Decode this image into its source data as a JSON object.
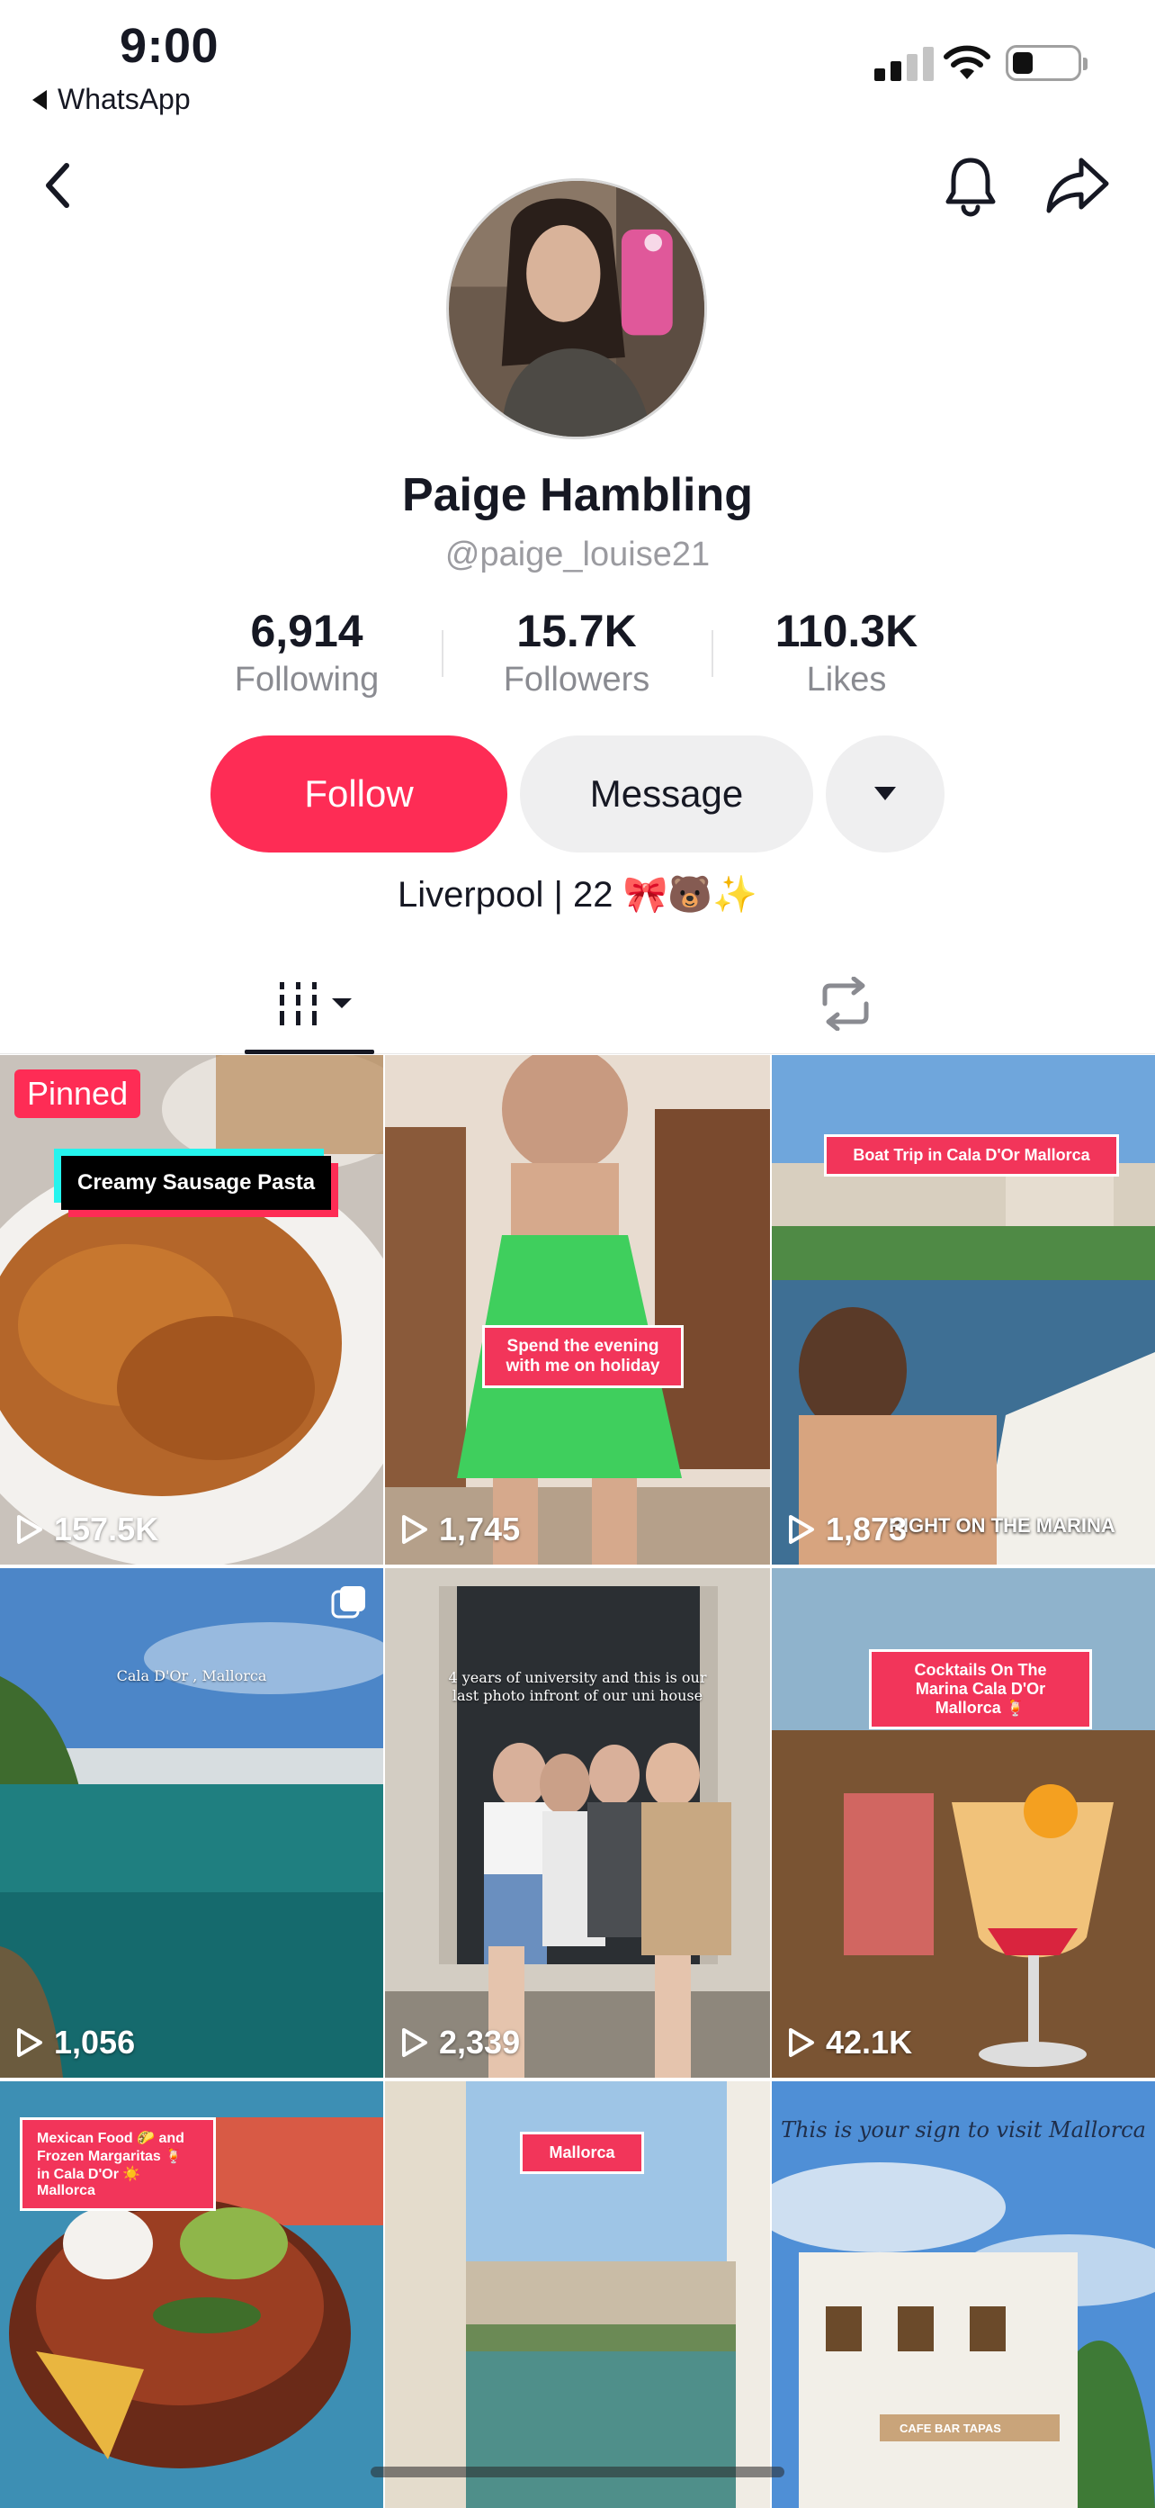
{
  "status_bar": {
    "time": "9:00",
    "back_app": "WhatsApp"
  },
  "profile": {
    "name": "Paige Hambling",
    "handle": "@paige_louise21",
    "bio": "Liverpool | 22 🎀🐻✨",
    "stats": [
      {
        "value": "6,914",
        "label": "Following"
      },
      {
        "value": "15.7K",
        "label": "Followers"
      },
      {
        "value": "110.3K",
        "label": "Likes"
      }
    ]
  },
  "actions": {
    "follow": "Follow",
    "message": "Message"
  },
  "colors": {
    "accent": "#fe2c55",
    "secondary_button": "#efeff0",
    "text": "#161823",
    "muted": "#8a8b91"
  },
  "videos": [
    {
      "views": "157.5K",
      "badge": "Pinned",
      "caption": "Creamy Sausage Pasta"
    },
    {
      "views": "1,745",
      "caption": "Spend the evening with me on holiday"
    },
    {
      "views": "1,873",
      "caption": "Boat Trip in Cala D'Or Mallorca",
      "overlay": "RIGHT ON THE MARINA"
    },
    {
      "views": "1,056",
      "caption": "Cala D'Or , Mallorca"
    },
    {
      "views": "2,339",
      "caption": "4 years of university and this is our last photo infront of our uni house"
    },
    {
      "views": "42.1K",
      "caption": "Cocktails On The Marina Cala D'Or Mallorca 🍹"
    },
    {
      "caption": "Mexican Food 🌮 and Frozen Margaritas 🍹 in Cala D'Or ☀️ Mallorca"
    },
    {
      "caption": "Mallorca"
    },
    {
      "caption": "This is your sign to visit Mallorca",
      "signs": [
        "CAFE BAR TAPAS"
      ]
    }
  ]
}
